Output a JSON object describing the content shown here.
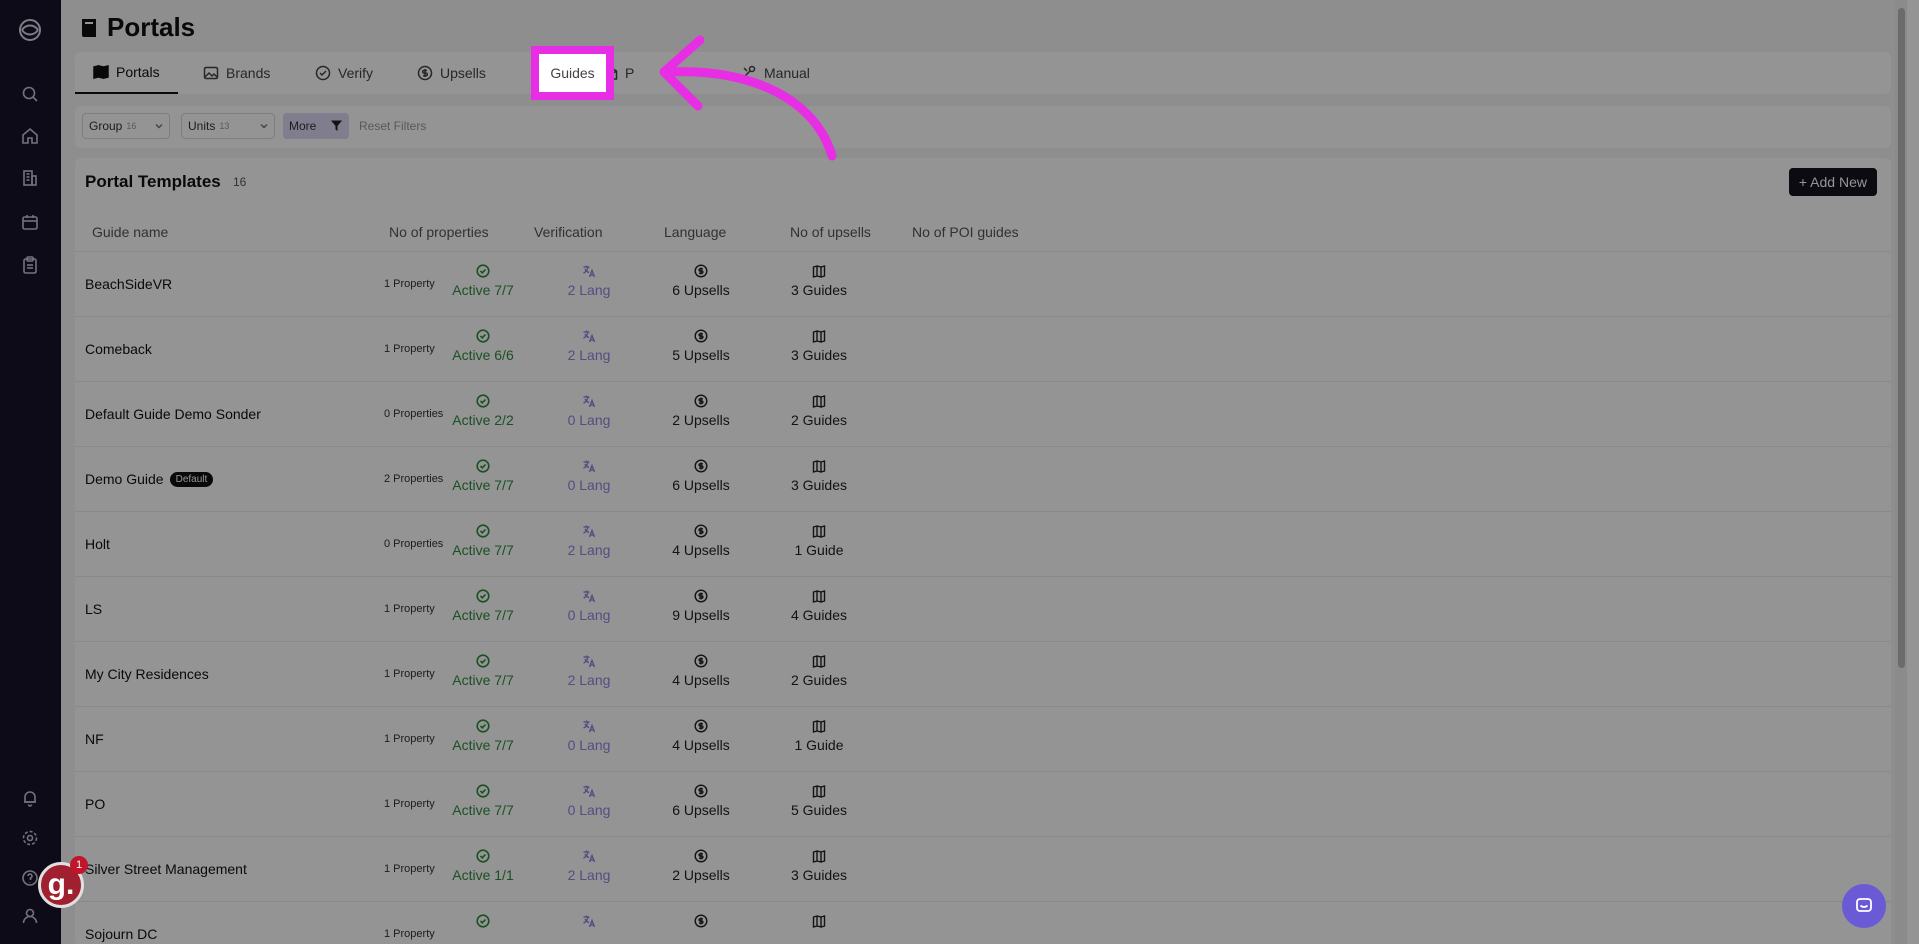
{
  "page": {
    "title": "Portals"
  },
  "tabs": [
    {
      "label": "Portals",
      "icon": "map-book-icon"
    },
    {
      "label": "Brands",
      "icon": "image-icon"
    },
    {
      "label": "Verify",
      "icon": "check-circle-icon"
    },
    {
      "label": "Upsells",
      "icon": "dollar-circle-icon"
    },
    {
      "label": "Guides",
      "icon": "book-icon"
    },
    {
      "label": "P",
      "icon": "envelope-icon"
    },
    {
      "label": "Manual",
      "icon": "settings-icon"
    }
  ],
  "filters": {
    "group": {
      "label": "Group",
      "count": "16"
    },
    "units": {
      "label": "Units",
      "count": "13"
    },
    "more": "More",
    "reset": "Reset Filters"
  },
  "table": {
    "title": "Portal Templates",
    "count": "16",
    "add_button": "+ Add New",
    "columns": [
      "Guide name",
      "No of properties",
      "Verification",
      "Language",
      "No of upsells",
      "No of POI guides"
    ],
    "rows": [
      {
        "name": "BeachSideVR",
        "badge": "",
        "properties": "1 Property",
        "verification": "Active 7/7",
        "language": "2 Lang",
        "upsells": "6 Upsells",
        "guides": "3 Guides"
      },
      {
        "name": "Comeback",
        "badge": "",
        "properties": "1 Property",
        "verification": "Active 6/6",
        "language": "2 Lang",
        "upsells": "5 Upsells",
        "guides": "3 Guides"
      },
      {
        "name": "Default Guide Demo Sonder",
        "badge": "",
        "properties": "0 Properties",
        "verification": "Active 2/2",
        "language": "0 Lang",
        "upsells": "2 Upsells",
        "guides": "2 Guides"
      },
      {
        "name": "Demo Guide",
        "badge": "Default",
        "properties": "2 Properties",
        "verification": "Active 7/7",
        "language": "0 Lang",
        "upsells": "6 Upsells",
        "guides": "3 Guides"
      },
      {
        "name": "Holt",
        "badge": "",
        "properties": "0 Properties",
        "verification": "Active 7/7",
        "language": "2 Lang",
        "upsells": "4 Upsells",
        "guides": "1 Guide"
      },
      {
        "name": "LS",
        "badge": "",
        "properties": "1 Property",
        "verification": "Active 7/7",
        "language": "0 Lang",
        "upsells": "9 Upsells",
        "guides": "4 Guides"
      },
      {
        "name": "My City Residences",
        "badge": "",
        "properties": "1 Property",
        "verification": "Active 7/7",
        "language": "2 Lang",
        "upsells": "4 Upsells",
        "guides": "2 Guides"
      },
      {
        "name": "NF",
        "badge": "",
        "properties": "1 Property",
        "verification": "Active 7/7",
        "language": "0 Lang",
        "upsells": "4 Upsells",
        "guides": "1 Guide"
      },
      {
        "name": "PO",
        "badge": "",
        "properties": "1 Property",
        "verification": "Active 7/7",
        "language": "0 Lang",
        "upsells": "6 Upsells",
        "guides": "5 Guides"
      },
      {
        "name": "Silver Street Management",
        "badge": "",
        "properties": "1 Property",
        "verification": "Active 1/1",
        "language": "2 Lang",
        "upsells": "2 Upsells",
        "guides": "3 Guides"
      },
      {
        "name": "Sojourn DC",
        "badge": "",
        "properties": "1 Property",
        "verification": "",
        "language": "",
        "upsells": "",
        "guides": ""
      }
    ]
  },
  "sidebar": {
    "icons": [
      "logo-icon",
      "search-icon",
      "home-icon",
      "building-icon",
      "calendar-icon",
      "clipboard-icon",
      "bell-icon",
      "gear-icon",
      "help-icon",
      "user-icon"
    ]
  },
  "widget": {
    "letter": "g.",
    "badge": "1"
  },
  "highlight": {
    "label": "Guides",
    "color": "#e82ee4"
  }
}
